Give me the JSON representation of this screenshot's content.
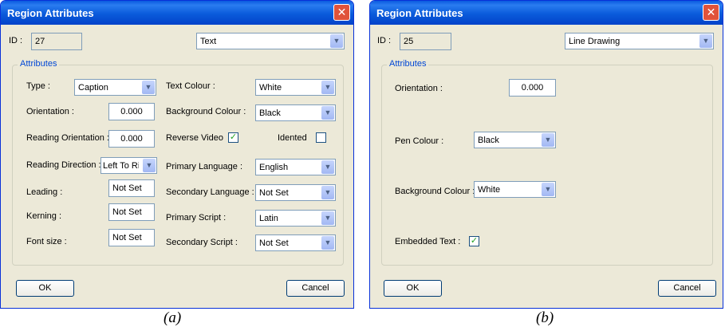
{
  "captions": {
    "a": "(a)",
    "b": "(b)"
  },
  "dialog_a": {
    "title": "Region Attributes",
    "id_label": "ID :",
    "id_value": "27",
    "region_type": "Text",
    "group_title": "Attributes",
    "type_label": "Type :",
    "type_value": "Caption",
    "orientation_label": "Orientation :",
    "orientation_value": "0.000",
    "reading_orientation_label": "Reading Orientation :",
    "reading_orientation_value": "0.000",
    "reading_direction_label": "Reading Direction :",
    "reading_direction_value": "Left To Ri",
    "leading_label": "Leading :",
    "leading_value": "Not Set",
    "kerning_label": "Kerning :",
    "kerning_value": "Not Set",
    "font_size_label": "Font size :",
    "font_size_value": "Not Set",
    "text_colour_label": "Text Colour :",
    "text_colour_value": "White",
    "background_colour_label": "Background Colour :",
    "background_colour_value": "Black",
    "reverse_video_label": "Reverse Video",
    "reverse_video_checked": true,
    "idented_label": "Idented",
    "idented_checked": false,
    "primary_language_label": "Primary Language :",
    "primary_language_value": "English",
    "secondary_language_label": "Secondary Language :",
    "secondary_language_value": "Not Set",
    "primary_script_label": "Primary Script :",
    "primary_script_value": "Latin",
    "secondary_script_label": "Secondary Script :",
    "secondary_script_value": "Not Set",
    "ok_label": "OK",
    "cancel_label": "Cancel"
  },
  "dialog_b": {
    "title": "Region Attributes",
    "id_label": "ID :",
    "id_value": "25",
    "region_type": "Line Drawing",
    "group_title": "Attributes",
    "orientation_label": "Orientation :",
    "orientation_value": "0.000",
    "pen_colour_label": "Pen Colour :",
    "pen_colour_value": "Black",
    "background_colour_label": "Background Colour :",
    "background_colour_value": "White",
    "embedded_text_label": "Embedded Text :",
    "embedded_text_checked": true,
    "ok_label": "OK",
    "cancel_label": "Cancel"
  },
  "icons": {
    "close": "close-icon",
    "dropdown": "chevron-down-icon",
    "check": "checkmark-icon"
  }
}
